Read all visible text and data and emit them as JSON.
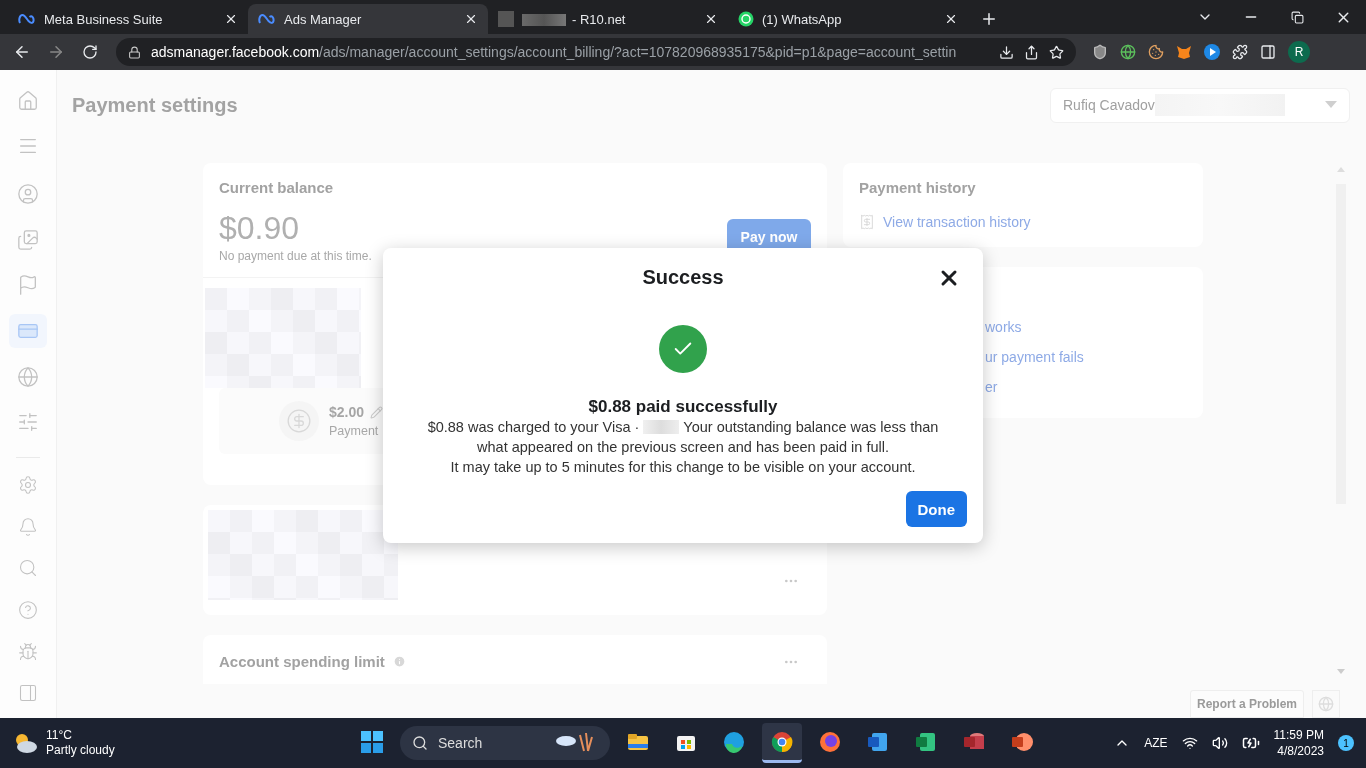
{
  "browser": {
    "tabs": [
      {
        "title": "Meta Business Suite",
        "selected": false,
        "kind": "meta"
      },
      {
        "title": "Ads Manager",
        "selected": true,
        "kind": "meta"
      },
      {
        "title": "- R10.net",
        "selected": false,
        "kind": "blurred"
      },
      {
        "title": "(1) WhatsApp",
        "selected": false,
        "kind": "whatsapp"
      }
    ],
    "address": {
      "host": "adsmanager.facebook.com",
      "path": "/ads/manager/account_settings/account_billing/?act=107820968935175&pid=p1&page=account_settin"
    },
    "profile_initial": "R"
  },
  "sidebar": {
    "top_items": [
      {
        "selected": false
      },
      {
        "selected": false
      },
      {
        "selected": false
      },
      {
        "selected": false
      },
      {
        "selected": false
      },
      {
        "selected": true
      },
      {
        "selected": false
      },
      {
        "selected": false
      }
    ],
    "bottom_items": [
      {
        "selected": false
      },
      {
        "selected": false
      },
      {
        "selected": false
      },
      {
        "selected": false
      },
      {
        "selected": false
      },
      {
        "selected": false
      }
    ]
  },
  "page": {
    "title": "Payment settings",
    "account": {
      "name": "Rufiq Cavadov"
    }
  },
  "balance_card": {
    "title": "Current balance",
    "amount": "$0.90",
    "note": "No payment due at this time.",
    "pay_button": "Pay now",
    "threshold": {
      "amount": "$2.00",
      "label": "Payment"
    }
  },
  "spending_limit": {
    "title": "Account spending limit"
  },
  "payment_history": {
    "title": "Payment history",
    "link": "View transaction history"
  },
  "help_links": [
    "works",
    "ur payment fails",
    "er"
  ],
  "footer": {
    "report_button": "Report a Problem"
  },
  "dialog": {
    "title": "Success",
    "heading": "$0.88 paid successfully",
    "charge_line": {
      "before": "$0.88 was charged to your Visa ·",
      "after": "Your outstanding balance was less than"
    },
    "lines": [
      "what appeared on the previous screen and has been paid in full.",
      "It may take up to 5 minutes for this change to be visible on your account."
    ],
    "done_button": "Done"
  },
  "taskbar": {
    "weather": {
      "temp": "11°C",
      "condition": "Partly cloudy"
    },
    "search": "Search",
    "apps": [
      {
        "kind": "files",
        "selected": false
      },
      {
        "kind": "store",
        "selected": false
      },
      {
        "kind": "edge",
        "selected": false
      },
      {
        "kind": "chrome",
        "selected": true
      },
      {
        "kind": "firefox",
        "selected": false
      },
      {
        "kind": "word",
        "selected": false
      },
      {
        "kind": "excel",
        "selected": false
      },
      {
        "kind": "access",
        "selected": false
      },
      {
        "kind": "powerpoint",
        "selected": false
      }
    ],
    "language": "AZE",
    "time": "11:59 PM",
    "date": "4/8/2023",
    "notifications": "1"
  }
}
